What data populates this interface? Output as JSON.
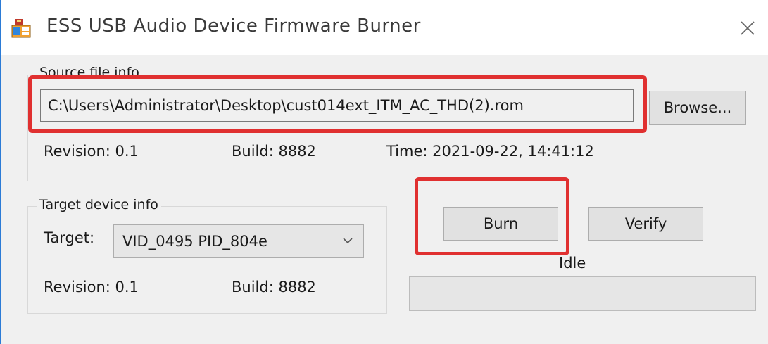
{
  "window": {
    "title": "ESS USB Audio Device Firmware Burner"
  },
  "icons": {
    "app": "app-icon",
    "close": "close-icon",
    "dropdown": "chevron-down-icon"
  },
  "source": {
    "group_label": "Source file info",
    "path_value": "C:\\Users\\Administrator\\Desktop\\cust014ext_ITM_AC_THD(2).rom",
    "browse_label": "Browse...",
    "revision_label": "Revision: 0.1",
    "build_label": "Build:  8882",
    "time_label": "Time:  2021-09-22, 14:41:12"
  },
  "target": {
    "group_label": "Target device info",
    "target_label": "Target:",
    "selected": "VID_0495  PID_804e",
    "revision_label": "Revision: 0.1",
    "build_label": "Build:  8882"
  },
  "actions": {
    "burn_label": "Burn",
    "verify_label": "Verify",
    "status_text": "Idle",
    "progress": 0
  },
  "colors": {
    "highlight": "#e03030",
    "accent": "#2b7bd6"
  }
}
